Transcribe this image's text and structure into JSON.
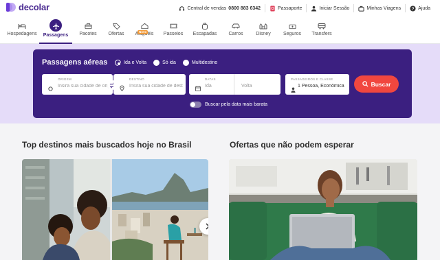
{
  "brand": {
    "name": "decolar"
  },
  "top_links": [
    {
      "icon": "headset-icon",
      "label": "Central de vendas",
      "phone": "0800 883 6342"
    },
    {
      "icon": "passport-icon",
      "label": "Passaporte"
    },
    {
      "icon": "user-icon",
      "label": "Iniciar Sessão"
    },
    {
      "icon": "suitcase-icon",
      "label": "Minhas Viagens"
    },
    {
      "icon": "help-icon",
      "label": "Ajuda"
    }
  ],
  "nav": {
    "items": [
      {
        "label": "Hospedagens",
        "icon": "bed-icon"
      },
      {
        "label": "Passagens",
        "icon": "plane-icon",
        "active": true
      },
      {
        "label": "Pacotes",
        "icon": "package-icon"
      },
      {
        "label": "Ofertas",
        "icon": "tag-icon"
      },
      {
        "label": "Aluguéis",
        "icon": "house-icon",
        "badge": "Novo"
      },
      {
        "label": "Passeios",
        "icon": "ticket-icon"
      },
      {
        "label": "Escapadas",
        "icon": "backpack-icon"
      },
      {
        "label": "Carros",
        "icon": "car-icon"
      },
      {
        "label": "Disney",
        "icon": "castle-icon"
      },
      {
        "label": "Seguros",
        "icon": "shield-icon"
      },
      {
        "label": "Transfers",
        "icon": "shuttle-icon"
      }
    ]
  },
  "search": {
    "title": "Passagens aéreas",
    "trip_types": [
      {
        "label": "Ida e Volta",
        "selected": true
      },
      {
        "label": "Só ida",
        "selected": false
      },
      {
        "label": "Multidestino",
        "selected": false
      }
    ],
    "origin": {
      "label": "ORIGEM",
      "placeholder": "Insira sua cidade de origem"
    },
    "destination": {
      "label": "DESTINO",
      "placeholder": "Insira sua cidade de destino"
    },
    "dates": {
      "label": "DATAS",
      "depart_placeholder": "Ida",
      "return_placeholder": "Volta"
    },
    "passengers": {
      "label": "PASSAGEIROS E CLASSE",
      "value": "1 Pessoa, Econômica"
    },
    "submit_label": "Buscar",
    "flexible_dates_label": "Buscar pela data mais barata"
  },
  "sections": {
    "top_destinations_title": "Top destinos mais buscados hoje no Brasil",
    "offers_title": "Ofertas que não podem esperar"
  },
  "colors": {
    "brand_purple": "#3b1f80",
    "hero_bg": "#e5dcf9",
    "search_button": "#f1473f"
  }
}
